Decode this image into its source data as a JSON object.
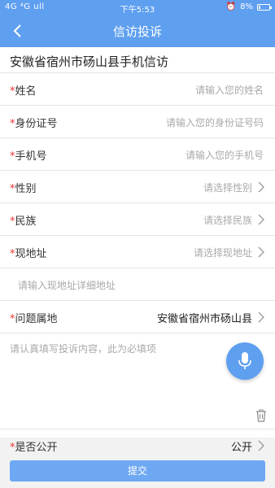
{
  "status_bar": {
    "carrier": "4G ⁴G ull",
    "time": "下午5:53",
    "battery": "8%"
  },
  "nav": {
    "title": "信访投诉"
  },
  "form": {
    "heading": "安徽省宿州市砀山县手机信访",
    "required_mark": "*",
    "fields": [
      {
        "label": "姓名",
        "placeholder": "请输入您的姓名"
      },
      {
        "label": "身份证号",
        "placeholder": "请输入您的身份证号码"
      },
      {
        "label": "手机号",
        "placeholder": "请输入您的手机号"
      },
      {
        "label": "性别",
        "placeholder": "请选择性别"
      },
      {
        "label": "民族",
        "placeholder": "请选择民族"
      },
      {
        "label": "现地址",
        "placeholder": "请选择现地址"
      }
    ],
    "address_detail_placeholder": "请输入现地址详细地址",
    "issue_location": {
      "label": "问题属地",
      "value": "安徽省宿州市砀山县"
    },
    "complaint_placeholder": "请认真填写投诉内容，此为必填项",
    "is_public": {
      "label": "是否公开",
      "value": "公开"
    }
  },
  "submit": {
    "label": "提交"
  }
}
